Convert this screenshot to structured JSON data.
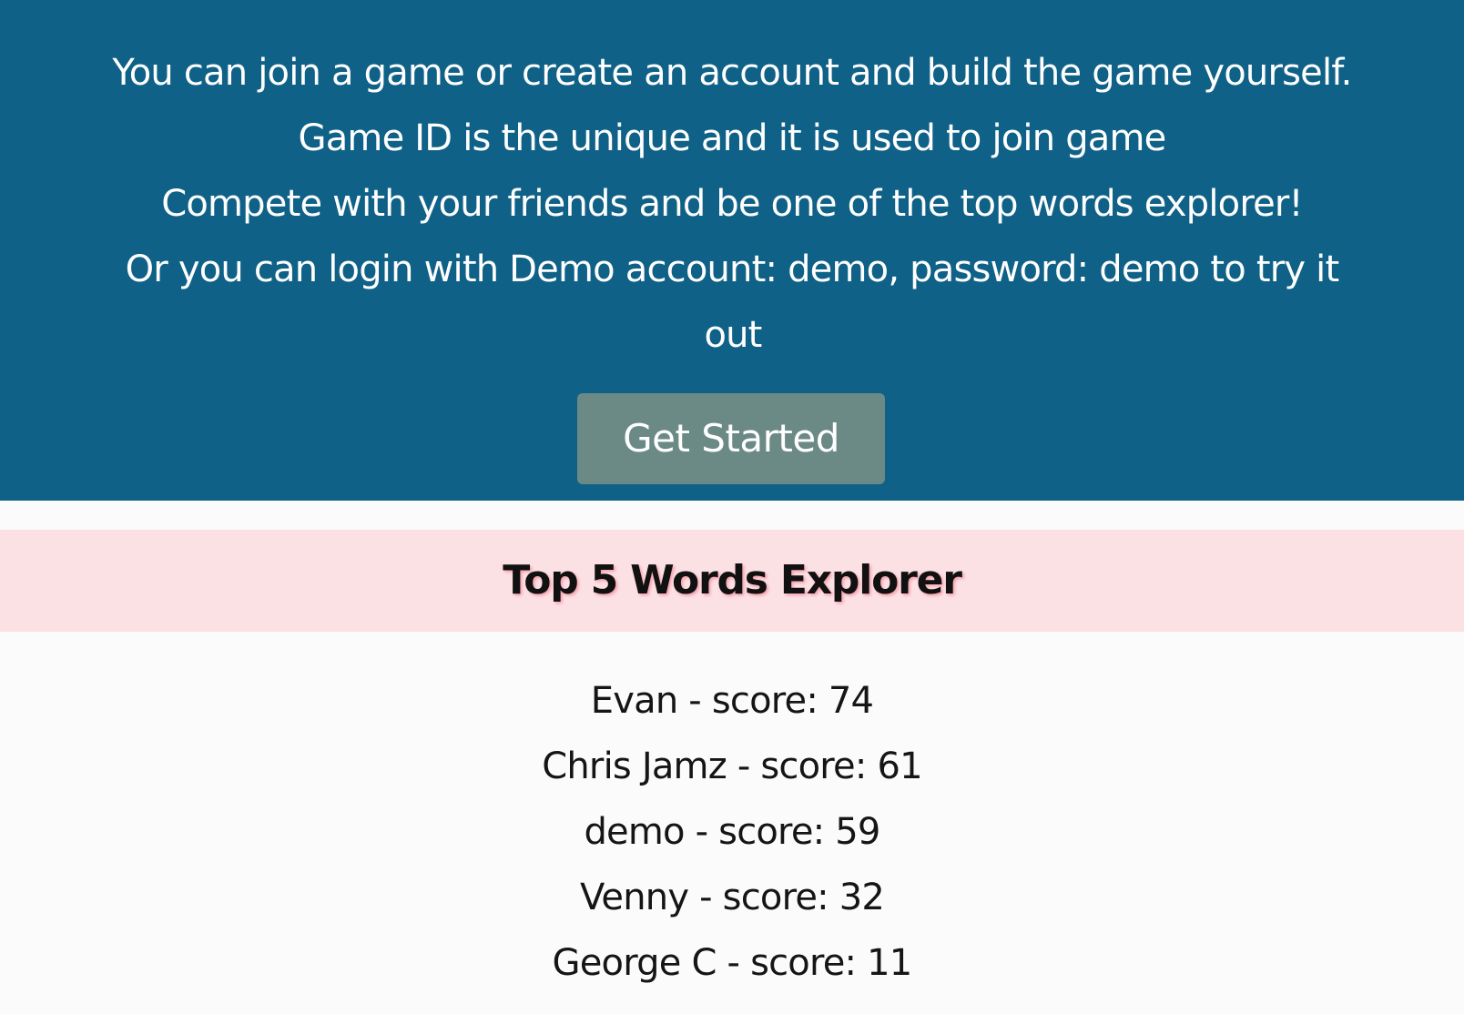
{
  "hero": {
    "lines": [
      "You can join a game or create an account and build the game yourself.",
      "Game ID is the unique and it is used to join game",
      "Compete with your friends and be one of the top words explorer!",
      "Or you can login with Demo account: demo, password: demo to try it",
      "out"
    ],
    "cta_label": "Get Started",
    "background_color": "#0f6187",
    "cta_color": "#6b8a86"
  },
  "leaderboard": {
    "title": "Top 5 Words Explorer",
    "header_color": "#fce1e4",
    "entries": [
      "Evan - score: 74",
      "Chris Jamz - score: 61",
      "demo - score: 59",
      "Venny - score: 32",
      "George C - score: 11"
    ]
  }
}
